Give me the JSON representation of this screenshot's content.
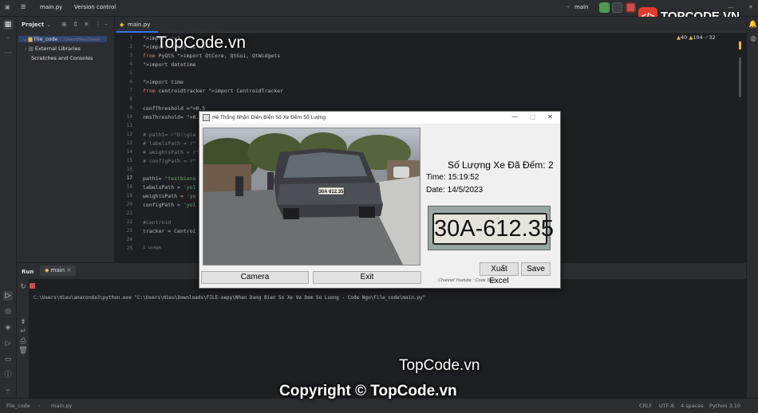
{
  "titlebar": {
    "project": "File_code",
    "vcs": "Version control",
    "run_config": "main",
    "branch": "main.py"
  },
  "project_panel": {
    "title": "Project",
    "items": [
      {
        "label": "File_code",
        "path": "C:\\Users\\Hieu\\Downl"
      },
      {
        "label": "External Libraries"
      },
      {
        "label": "Scratches and Consoles"
      }
    ]
  },
  "editor": {
    "tab": "main.py",
    "inspections": {
      "warnings": "40",
      "weak": "104",
      "typos": "32"
    },
    "lines": [
      {
        "n": "1",
        "text": "import cv2"
      },
      {
        "n": "2",
        "text": "import numpy as np"
      },
      {
        "n": "3",
        "text": "from PyQt5 import QtCore, QtGui, QtWidgets"
      },
      {
        "n": "4",
        "text": "import datetime"
      },
      {
        "n": "5",
        "text": ""
      },
      {
        "n": "6",
        "text": "import time"
      },
      {
        "n": "7",
        "text": "from centroidtracker import CentroidTracker"
      },
      {
        "n": "8",
        "text": ""
      },
      {
        "n": "9",
        "text": "confThreshold =0.5"
      },
      {
        "n": "10",
        "text": "nmsThreshold= 0.2"
      },
      {
        "n": "11",
        "text": ""
      },
      {
        "n": "12",
        "text": "# path1= r\"D:\\gie"
      },
      {
        "n": "13",
        "text": "# labelsPath = r\""
      },
      {
        "n": "14",
        "text": "# weightsPath = r\""
      },
      {
        "n": "15",
        "text": "# configPath = r\""
      },
      {
        "n": "16",
        "text": ""
      },
      {
        "n": "17",
        "text": "path1= \"testbiens"
      },
      {
        "n": "18",
        "text": "labelsPath = 'yol"
      },
      {
        "n": "19",
        "text": "weightsPath = 'yo"
      },
      {
        "n": "20",
        "text": "configPath = 'yol"
      },
      {
        "n": "21",
        "text": ""
      },
      {
        "n": "22",
        "text": "#centroid"
      },
      {
        "n": "23",
        "text": "tracker = Centroi"
      },
      {
        "n": "24",
        "text": ""
      },
      {
        "n": "25",
        "text": "1 usage"
      }
    ]
  },
  "run": {
    "title": "Run",
    "tab": "main",
    "command": "C:\\Users\\Hieu\\anaconda3\\python.exe \"C:\\Users\\Hieu\\Downloads\\FILE-xepy\\Nhan Dang Bien So Xe Va Dem So Luong - Code Ngo\\File_code\\main.py\""
  },
  "status": {
    "path1": "File_code",
    "path2": "main.py",
    "line_sep": "CRLF",
    "encoding": "UTF-8",
    "indent": "4 spaces",
    "interpreter": "Python 3.10"
  },
  "dialog": {
    "title": "Hệ Thống Nhận Diện Biển Số Xe Đếm Số Lượng",
    "count_label": "Số Lượng Xe Đã Đếm: 2",
    "time_label": "Time: 15:19:52",
    "date_label": "Date: 14/5/2023",
    "plate_text": "30A-612.35",
    "car_plate": "30A 612.35",
    "camera_button": "Camera",
    "exit_button": "Exit",
    "excel_button": "Xuất Excel",
    "save_button": "Save",
    "credit": "Channel Youtube : Code Ngo"
  },
  "watermark": {
    "logo": "TOPCODE.VN",
    "top": "TopCode.vn",
    "mid": "TopCode.vn",
    "copyright": "Copyright © TopCode.vn"
  },
  "colors": {
    "accent": "#3574f0",
    "ide_bg": "#1e1f22",
    "panel_bg": "#2b2d30",
    "logo_red": "#e33b2e"
  }
}
